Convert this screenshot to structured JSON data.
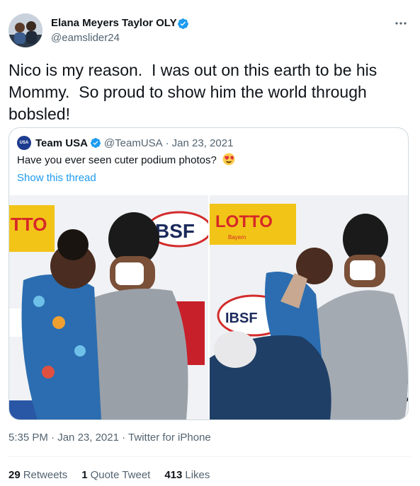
{
  "author": {
    "name": "Elana Meyers Taylor OLY",
    "handle": "@eamslider24",
    "verified": true
  },
  "tweet": {
    "text": "Nico is my reason.  I was out on this earth to be his Mommy.  So proud to show him the world through bobsled!"
  },
  "quoted": {
    "avatar_text": "USA",
    "name": "Team USA",
    "handle": "@TeamUSA",
    "separator": "·",
    "date": "Jan 23, 2021",
    "text": "Have you ever seen cuter podium photos?",
    "emoji": "heart-eyes-emoji",
    "show_thread": "Show this thread",
    "photo_left_sponsor": "TTO",
    "photo_left_logo": "BSF",
    "photo_right_sponsor": "LOTTO",
    "photo_right_sub": "Bayern",
    "photo_right_logo": "IBSF"
  },
  "meta": {
    "time": "5:35 PM",
    "separator": "·",
    "date": "Jan 23, 2021",
    "source": "Twitter for iPhone"
  },
  "stats": {
    "retweets_count": "29",
    "retweets_label": "Retweets",
    "quote_count": "1",
    "quote_label": "Quote Tweet",
    "likes_count": "413",
    "likes_label": "Likes"
  },
  "colors": {
    "link": "#1d9bf0",
    "secondary_text": "#536471",
    "border": "#cfd9de"
  }
}
